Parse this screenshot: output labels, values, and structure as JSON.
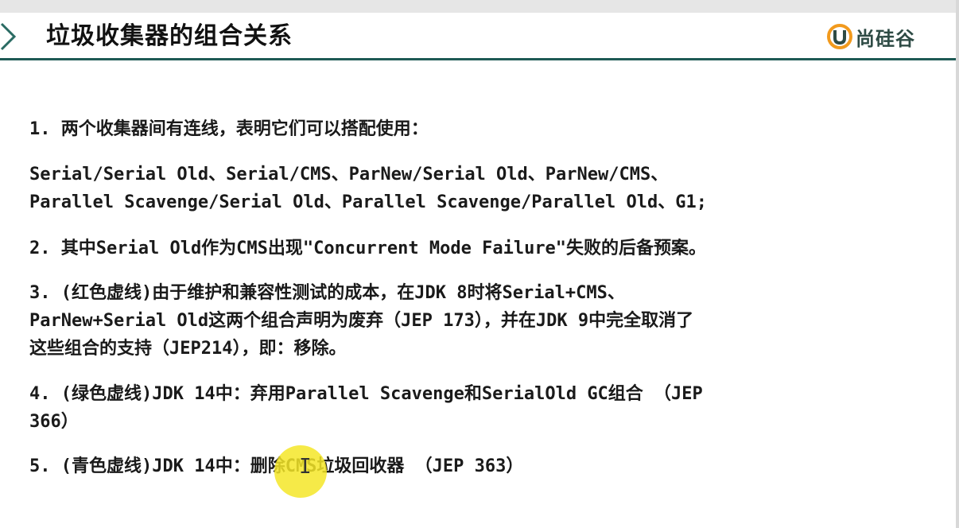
{
  "slide": {
    "title": "垃圾收集器的组合关系",
    "logo_text": "尚硅谷",
    "items": [
      "1. 两个收集器间有连线，表明它们可以搭配使用：",
      "Serial/Serial Old、Serial/CMS、ParNew/Serial Old、ParNew/CMS、",
      "Parallel Scavenge/Serial Old、Parallel Scavenge/Parallel Old、G1;",
      "2. 其中Serial Old作为CMS出现\"Concurrent Mode Failure\"失败的后备预案。",
      "3. (红色虚线)由于维护和兼容性测试的成本，在JDK 8时将Serial+CMS、",
      "ParNew+Serial Old这两个组合声明为废弃（JEP 173），并在JDK 9中完全取消了",
      "这些组合的支持（JEP214），即：移除。",
      "4. (绿色虚线)JDK 14中：弃用Parallel Scavenge和SerialOld GC组合 （JEP",
      "366）",
      "5. (青色虚线)JDK 14中：删除CMS垃圾回收器 （JEP 363）"
    ]
  },
  "colors": {
    "header_rule": "#1f5a55",
    "chevron": "#2a6b63",
    "logo_orange": "#f29a1d",
    "logo_green": "#2e4b45",
    "highlight": "#f5e628"
  },
  "icons": [
    "chevron-right-icon",
    "logo-icon",
    "text-cursor-icon"
  ]
}
